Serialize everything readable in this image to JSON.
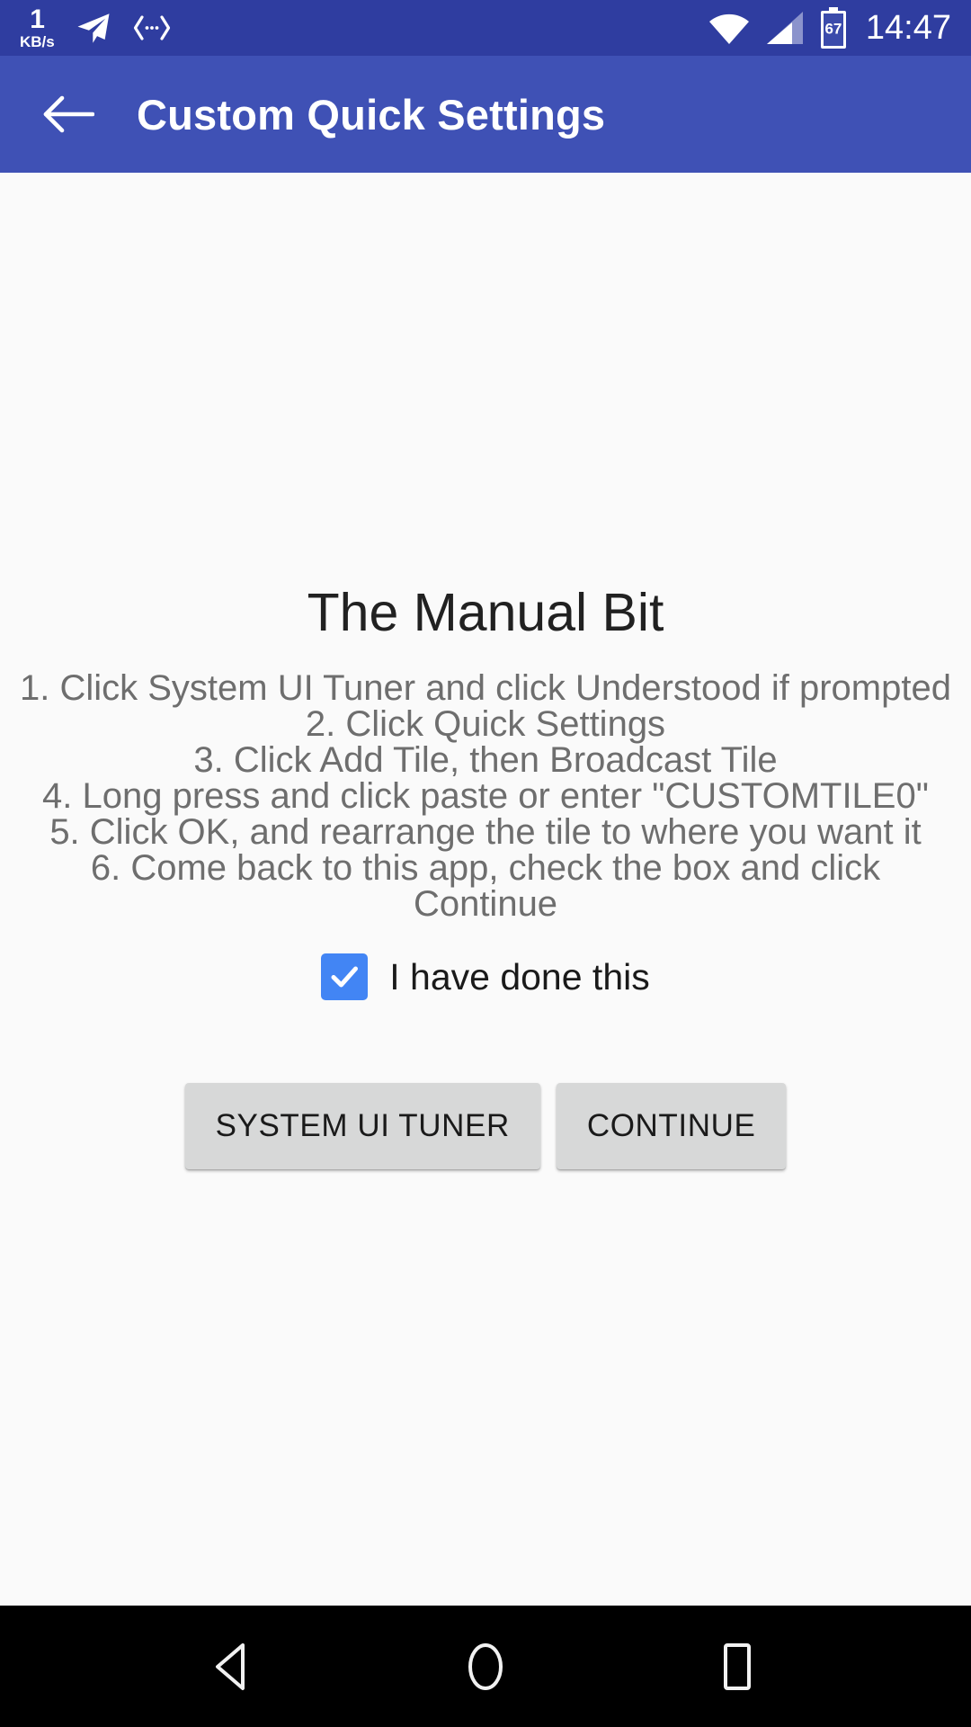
{
  "status_bar": {
    "background": "#2f3da0",
    "net_speed_value": "1",
    "net_speed_unit": "KB/s",
    "telegram_icon": "paper-plane-icon",
    "adb_icon": "developer-brackets-icon",
    "wifi_icon": "wifi-icon",
    "signal_icon": "cell-signal-icon",
    "battery_level": "67",
    "time": "14:47"
  },
  "app_bar": {
    "background": "#3f51b5",
    "back_icon": "back-arrow-icon",
    "title": "Custom Quick Settings"
  },
  "main": {
    "heading": "The Manual Bit",
    "instructions": [
      "1. Click System UI Tuner and click Understood if prompted",
      "2. Click Quick Settings",
      "3. Click Add Tile, then Broadcast Tile",
      "4. Long press and click paste or enter \"CUSTOMTILE0\"",
      "5. Click OK, and rearrange the tile to where you want it",
      "6. Come back to this app, check the box and click Continue"
    ],
    "checkbox": {
      "label": "I have done this",
      "checked": true,
      "accent_color": "#4285f4"
    },
    "buttons": [
      {
        "label": "SYSTEM UI TUNER",
        "name": "system-ui-tuner-button"
      },
      {
        "label": "CONTINUE",
        "name": "continue-button"
      }
    ]
  },
  "nav_bar": {
    "background": "#000000",
    "back": "nav-back-icon",
    "home": "nav-home-icon",
    "recents": "nav-recents-icon"
  }
}
